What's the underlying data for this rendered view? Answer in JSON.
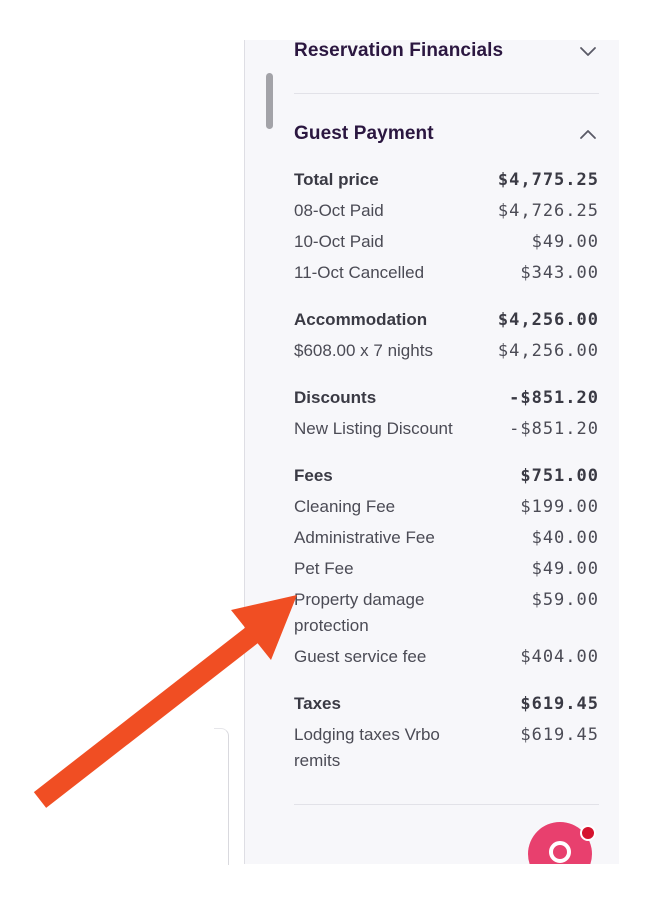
{
  "panel": {
    "reservation_financials": {
      "title": "Reservation Financials",
      "state": "collapsed",
      "toggle_icon": "chevron-down-icon"
    },
    "guest_payment": {
      "title": "Guest Payment",
      "state": "expanded",
      "toggle_icon": "chevron-up-icon",
      "total_price": {
        "label": "Total price",
        "amount": "$4,775.25",
        "items": [
          {
            "label": "08-Oct Paid",
            "amount": "$4,726.25"
          },
          {
            "label": "10-Oct Paid",
            "amount": "$49.00"
          },
          {
            "label": "11-Oct Cancelled",
            "amount": "$343.00"
          }
        ]
      },
      "accommodation": {
        "label": "Accommodation",
        "amount": "$4,256.00",
        "items": [
          {
            "label": "$608.00 x 7 nights",
            "amount": "$4,256.00"
          }
        ]
      },
      "discounts": {
        "label": "Discounts",
        "amount": "-$851.20",
        "items": [
          {
            "label": "New Listing Discount",
            "amount": "-$851.20"
          }
        ]
      },
      "fees": {
        "label": "Fees",
        "amount": "$751.00",
        "items": [
          {
            "label": "Cleaning Fee",
            "amount": "$199.00"
          },
          {
            "label": "Administrative Fee",
            "amount": "$40.00"
          },
          {
            "label": "Pet Fee",
            "amount": "$49.00"
          },
          {
            "label": "Property damage protection",
            "amount": "$59.00"
          },
          {
            "label": "Guest service fee",
            "amount": "$404.00"
          }
        ]
      },
      "taxes": {
        "label": "Taxes",
        "amount": "$619.45",
        "items": [
          {
            "label": "Lodging taxes Vrbo remits",
            "amount": "$619.45"
          }
        ]
      }
    },
    "chat_button": {
      "icon": "chat-ring-icon",
      "has_notification": true,
      "color": "#e8406e",
      "notification_color": "#d5132e"
    }
  },
  "annotation": {
    "icon": "arrow-annotation-icon",
    "color": "#f04e23"
  }
}
